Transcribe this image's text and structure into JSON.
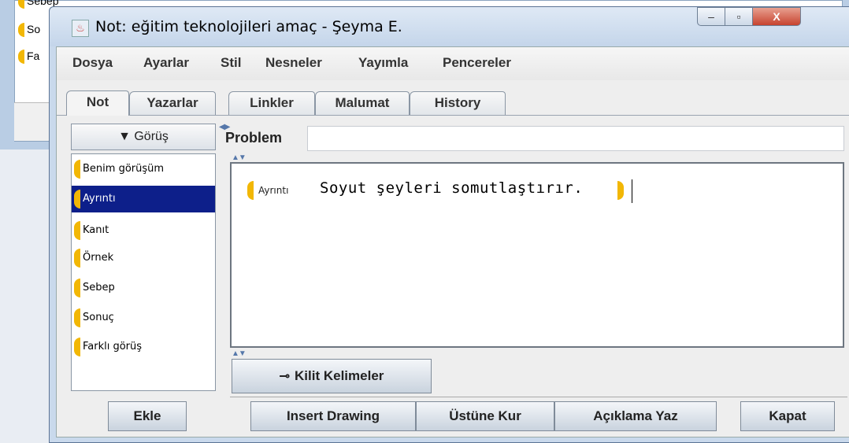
{
  "background_window": {
    "items": [
      "Sebep",
      "So",
      "Fa"
    ]
  },
  "window": {
    "title": "Not: eğitim teknolojileri amaç - Şeyma E.",
    "controls": {
      "minimize": "–",
      "maximize": "▫",
      "close": "X"
    }
  },
  "menu": {
    "items": [
      "Dosya",
      "Ayarlar",
      "Stil",
      "Nesneler",
      "Yayımla",
      "Pencereler"
    ]
  },
  "tabs": {
    "items": [
      "Not",
      "Yazarlar",
      "Linkler",
      "Malumat",
      "History"
    ],
    "active": "Not"
  },
  "left": {
    "dropdown_label": "▼ Görüş",
    "categories": [
      "Benim görüşüm",
      "Ayrıntı",
      "Kanıt",
      "Örnek",
      "Sebep",
      "Sonuç",
      "Farklı görüş"
    ],
    "selected": "Ayrıntı",
    "add_button": "Ekle"
  },
  "editor": {
    "problem_label": "Problem",
    "problem_value": "",
    "note_tag": "Ayrıntı",
    "note_text": "Soyut şeyleri somutlaştırır."
  },
  "buttons": {
    "keywords": "Kilit Kelimeler",
    "insert_drawing": "Insert Drawing",
    "ustune_kur": "Üstüne Kur",
    "aciklama_yaz": "Açıklama Yaz",
    "kapat": "Kapat"
  },
  "colors": {
    "scaffold_bracket": "#f2b705",
    "selection": "#0d1f8a"
  }
}
